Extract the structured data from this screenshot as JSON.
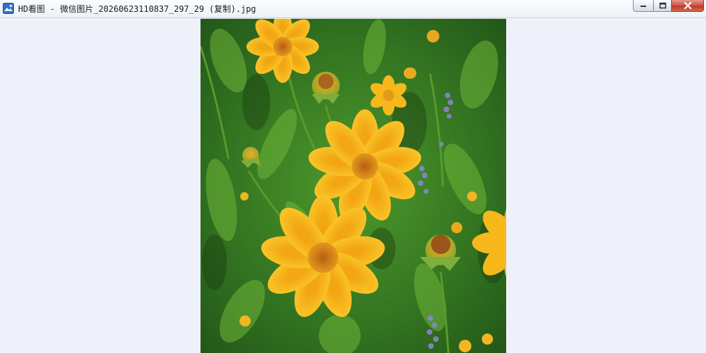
{
  "window": {
    "title": "HD看图 - 微信图片_20260623110837_297_29 (复制).jpg",
    "controls": {
      "minimize_icon": "minimize-icon",
      "maximize_icon": "restore-icon",
      "close_icon": "close-icon"
    }
  },
  "image": {
    "subject": "photo",
    "colors": {
      "petal": "#f6b81a",
      "center": "#d9861a",
      "foliage": "#3f8a2a",
      "lavender": "#8a85c8"
    }
  },
  "colors": {
    "background": "#eef1f9",
    "close_button": "#c94536"
  }
}
